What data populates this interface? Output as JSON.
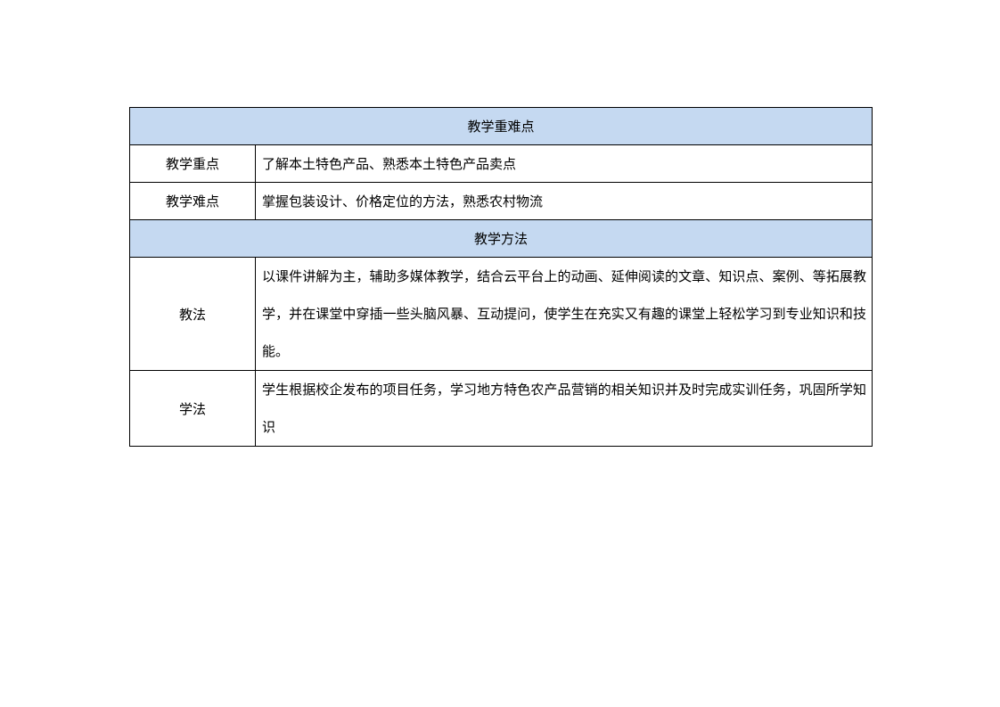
{
  "sections": {
    "key_points_header": "教学重难点",
    "methods_header": "教学方法"
  },
  "rows": {
    "key_point": {
      "label": "教学重点",
      "content": "了解本土特色产品、熟悉本土特色产品卖点"
    },
    "difficult_point": {
      "label": "教学难点",
      "content": "掌握包装设计、价格定位的方法，熟悉农村物流"
    },
    "teaching_method": {
      "label": "教法",
      "content": "以课件讲解为主，辅助多媒体教学，结合云平台上的动画、延伸阅读的文章、知识点、案例、等拓展教学，并在课堂中穿插一些头脑风暴、互动提问，使学生在充实又有趣的课堂上轻松学习到专业知识和技能。"
    },
    "learning_method": {
      "label": "学法",
      "content": "学生根据校企发布的项目任务，学习地方特色农产品营销的相关知识并及时完成实训任务，巩固所学知识"
    }
  }
}
